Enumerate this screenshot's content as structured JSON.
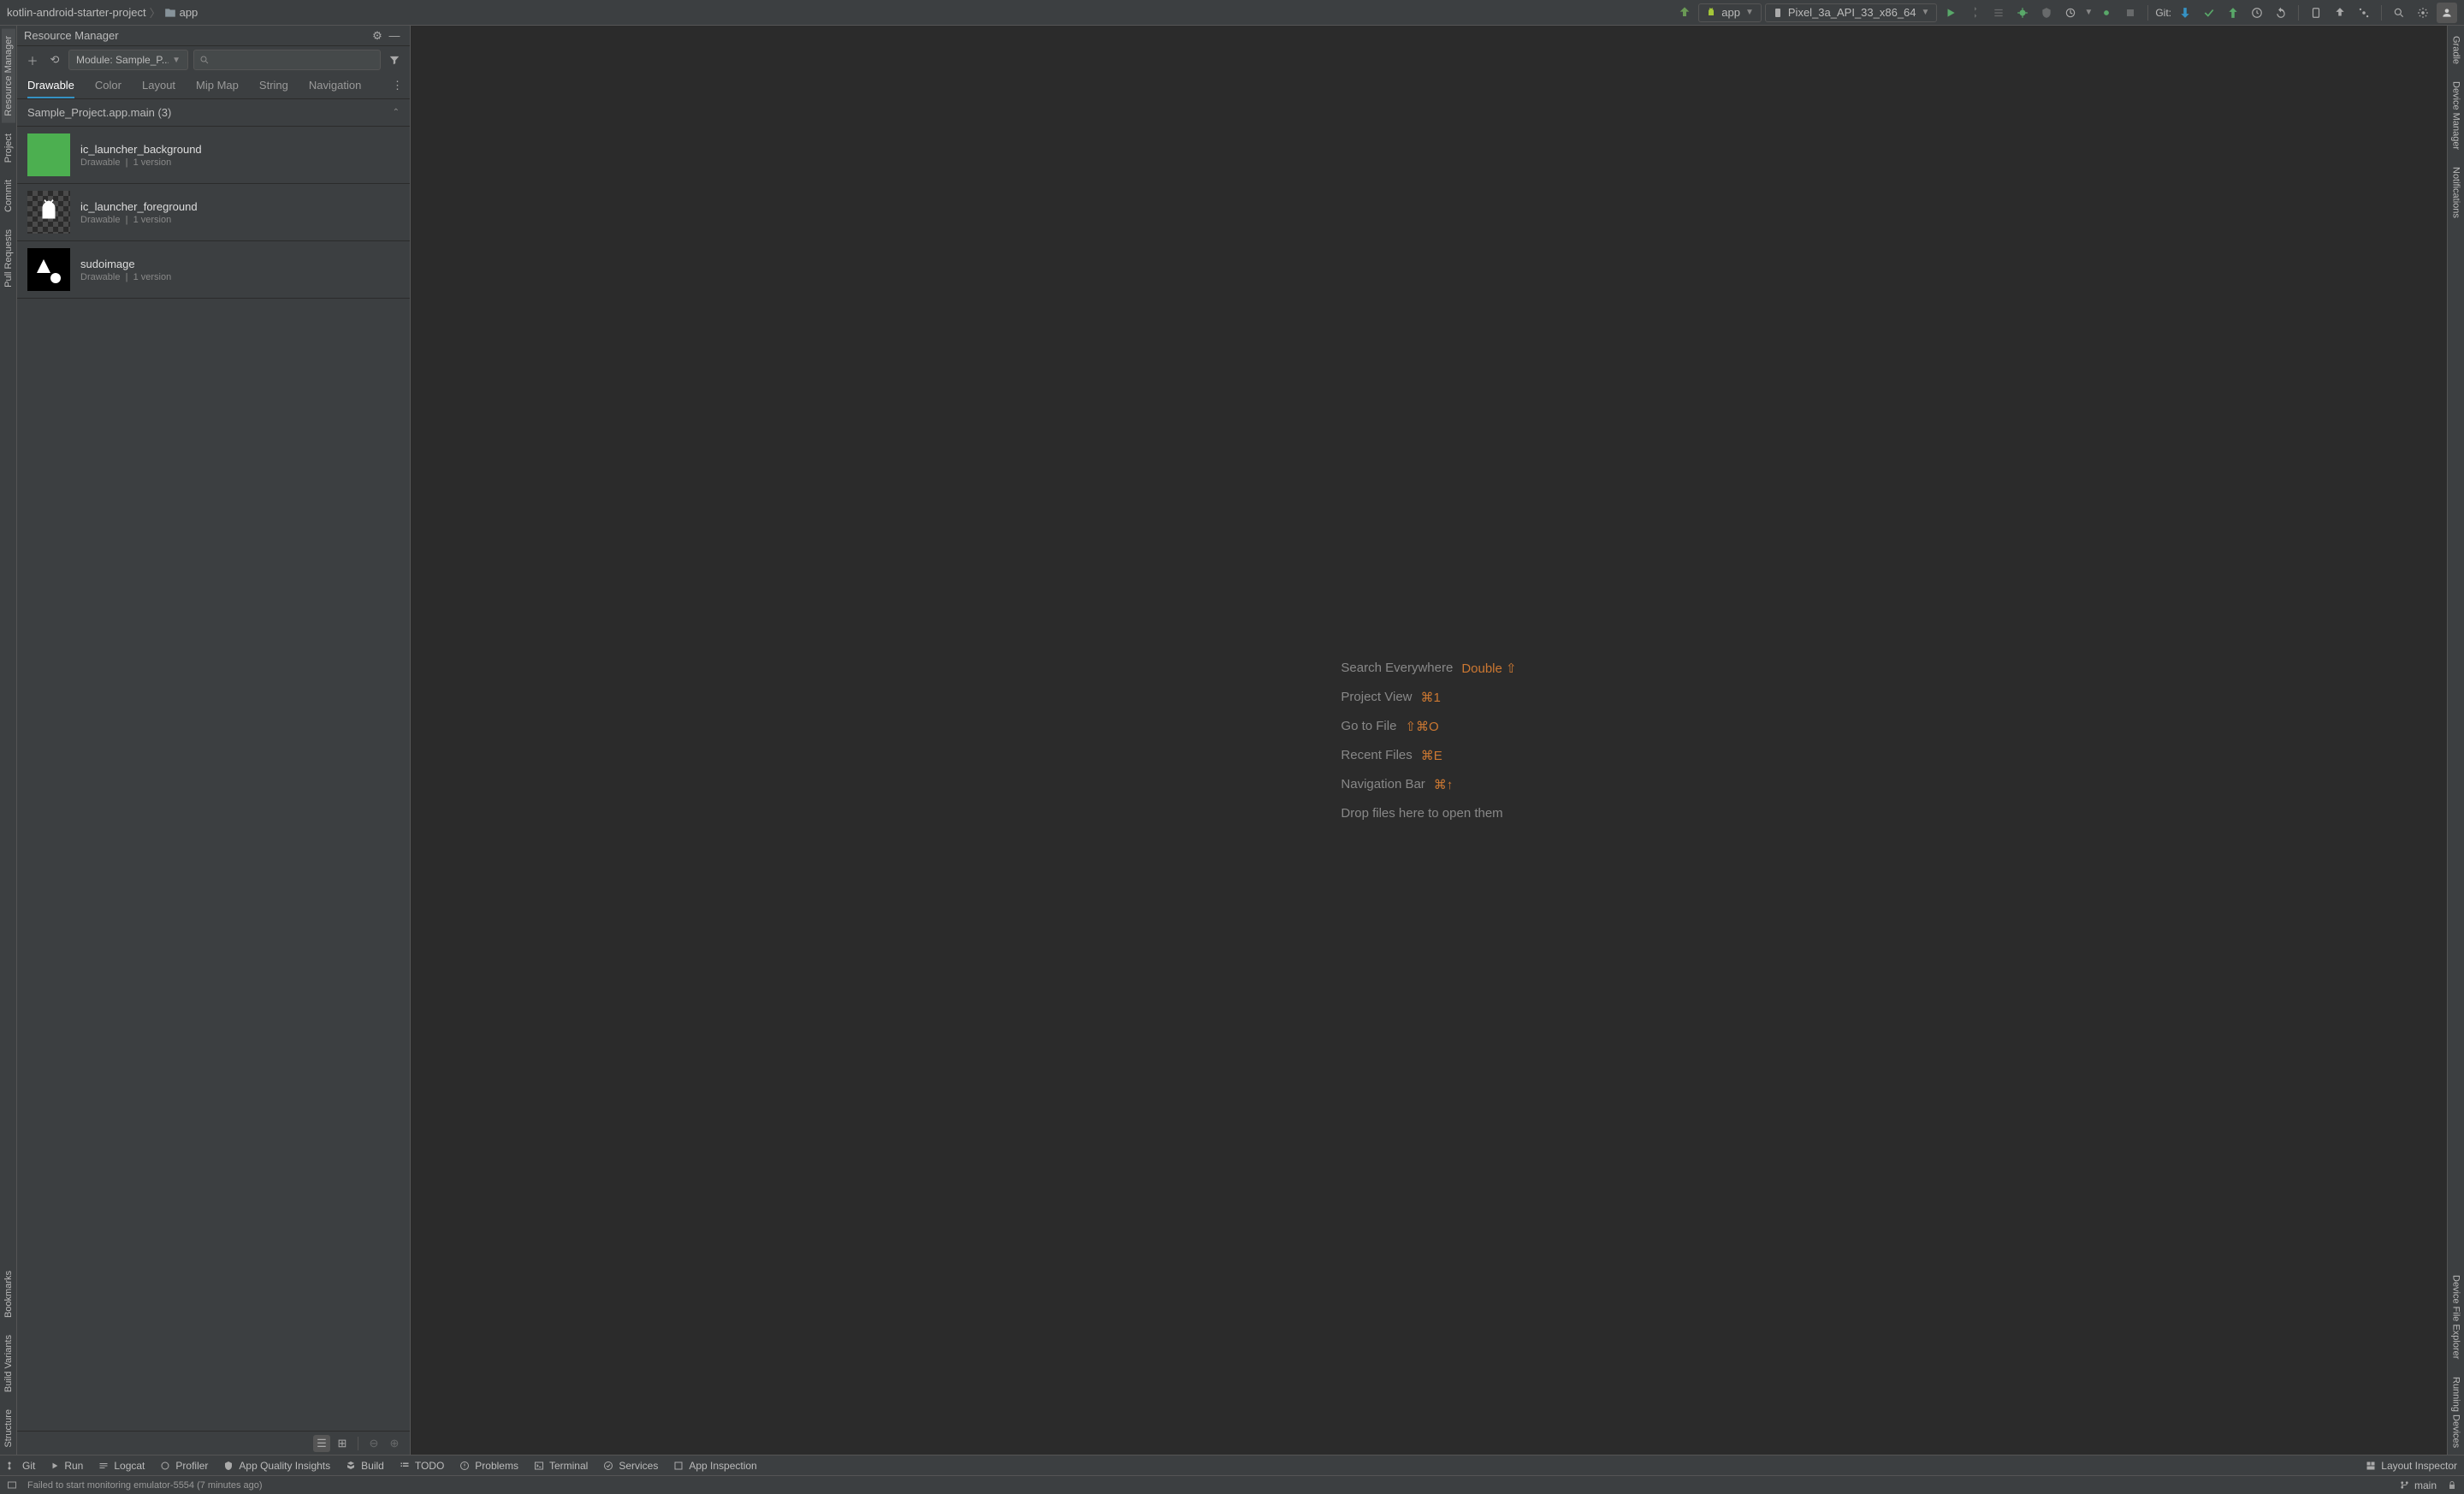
{
  "breadcrumb": {
    "project": "kotlin-android-starter-project",
    "module": "app"
  },
  "toolbar": {
    "run_config": "app",
    "device": "Pixel_3a_API_33_x86_64",
    "git_label": "Git:"
  },
  "left_rail": [
    "Resource Manager",
    "Project",
    "Commit",
    "Pull Requests",
    "Bookmarks",
    "Build Variants",
    "Structure"
  ],
  "right_rail": [
    "Gradle",
    "Device Manager",
    "Notifications",
    "Device File Explorer",
    "Running Devices"
  ],
  "panel": {
    "title": "Resource Manager",
    "module": "Module: Sample_P...",
    "search_placeholder": "",
    "tabs": [
      "Drawable",
      "Color",
      "Layout",
      "Mip Map",
      "String",
      "Navigation"
    ],
    "active_tab": 0,
    "section": "Sample_Project.app.main (3)"
  },
  "resources": [
    {
      "name": "ic_launcher_background",
      "type": "Drawable",
      "versions": "1 version",
      "thumb": "green"
    },
    {
      "name": "ic_launcher_foreground",
      "type": "Drawable",
      "versions": "1 version",
      "thumb": "android"
    },
    {
      "name": "sudoimage",
      "type": "Drawable",
      "versions": "1 version",
      "thumb": "shapes"
    }
  ],
  "empty_state": {
    "rows": [
      {
        "label": "Search Everywhere",
        "shortcut": "Double ⇧"
      },
      {
        "label": "Project View",
        "shortcut": "⌘1"
      },
      {
        "label": "Go to File",
        "shortcut": "⇧⌘O"
      },
      {
        "label": "Recent Files",
        "shortcut": "⌘E"
      },
      {
        "label": "Navigation Bar",
        "shortcut": "⌘↑"
      }
    ],
    "drop": "Drop files here to open them"
  },
  "bottom": {
    "items": [
      "Git",
      "Run",
      "Logcat",
      "Profiler",
      "App Quality Insights",
      "Build",
      "TODO",
      "Problems",
      "Terminal",
      "Services",
      "App Inspection"
    ],
    "right": "Layout Inspector"
  },
  "status": {
    "message": "Failed to start monitoring emulator-5554 (7 minutes ago)",
    "branch": "main"
  }
}
